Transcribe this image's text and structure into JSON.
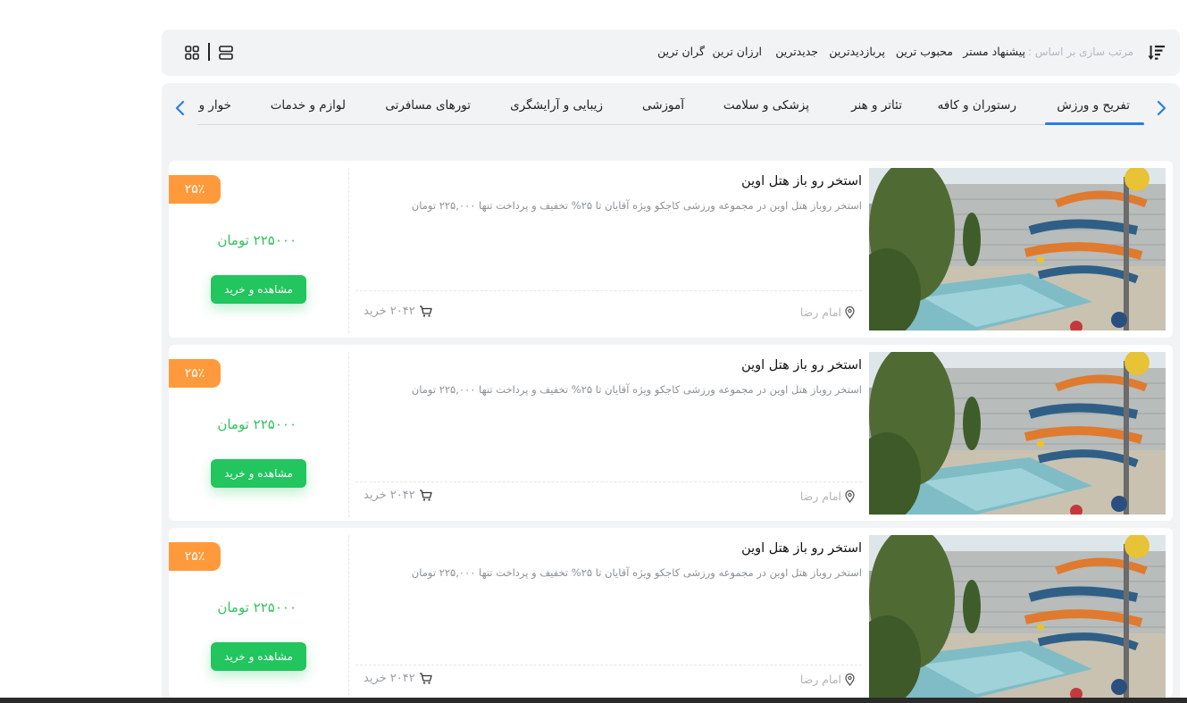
{
  "sort": {
    "prefix": "مرتب سازی بر اساس :",
    "options": [
      "پیشنهاد مستر",
      "محبوب ترین",
      "پربازدیدترین",
      "جدیدترین",
      "ارزان ترین",
      "گران ترین"
    ]
  },
  "categories": {
    "tabs": [
      "تفریح و ورزش",
      "رستوران و کافه",
      "تئاتر و هنر",
      "پزشکی و سلامت",
      "آموزشی",
      "زیبایی و آرایشگری",
      "تورهای مسافرتی",
      "لوازم و خدمات",
      "خوار و"
    ],
    "active_index": 0
  },
  "cards": [
    {
      "title": "استخر رو باز هتل اوین",
      "description": "استخر روباز هتل اوین در مجموعه ورزشی کاجکو ویژه آقایان تا ۲۵% تخفیف و پرداخت تنها ۲۲۵,۰۰۰ تومان",
      "location": "امام رضا",
      "purchases": "۲۰۴۲ خرید",
      "discount": "۲۵٪",
      "price": "۲۲۵۰۰۰ تومان",
      "button": "مشاهده و خرید"
    },
    {
      "title": "استخر رو باز هتل اوین",
      "description": "استخر روباز هتل اوین در مجموعه ورزشی کاجکو ویژه آقایان تا ۲۵% تخفیف و پرداخت تنها ۲۲۵,۰۰۰ تومان",
      "location": "امام رضا",
      "purchases": "۲۰۴۲ خرید",
      "discount": "۲۵٪",
      "price": "۲۲۵۰۰۰ تومان",
      "button": "مشاهده و خرید"
    },
    {
      "title": "استخر رو باز هتل اوین",
      "description": "استخر روباز هتل اوین در مجموعه ورزشی کاجکو ویژه آقایان تا ۲۵% تخفیف و پرداخت تنها ۲۲۵,۰۰۰ تومان",
      "location": "امام رضا",
      "purchases": "۲۰۴۲ خرید",
      "discount": "۲۵٪",
      "price": "۲۲۵۰۰۰ تومان",
      "button": "مشاهده و خرید"
    }
  ],
  "colors": {
    "accent_blue": "#2d7de0",
    "buy_green": "#22c55e",
    "price_green": "#31c25f",
    "discount_orange": "#ff9a3c",
    "panel_gray": "#f1f3f5"
  },
  "icons": {
    "sort": "sort-descending-icon",
    "grid_view": "grid-view-icon",
    "list_view": "list-view-icon",
    "arrow_prev": "chevron-right-icon",
    "arrow_next": "chevron-left-icon",
    "location": "map-pin-icon",
    "cart": "cart-icon"
  }
}
